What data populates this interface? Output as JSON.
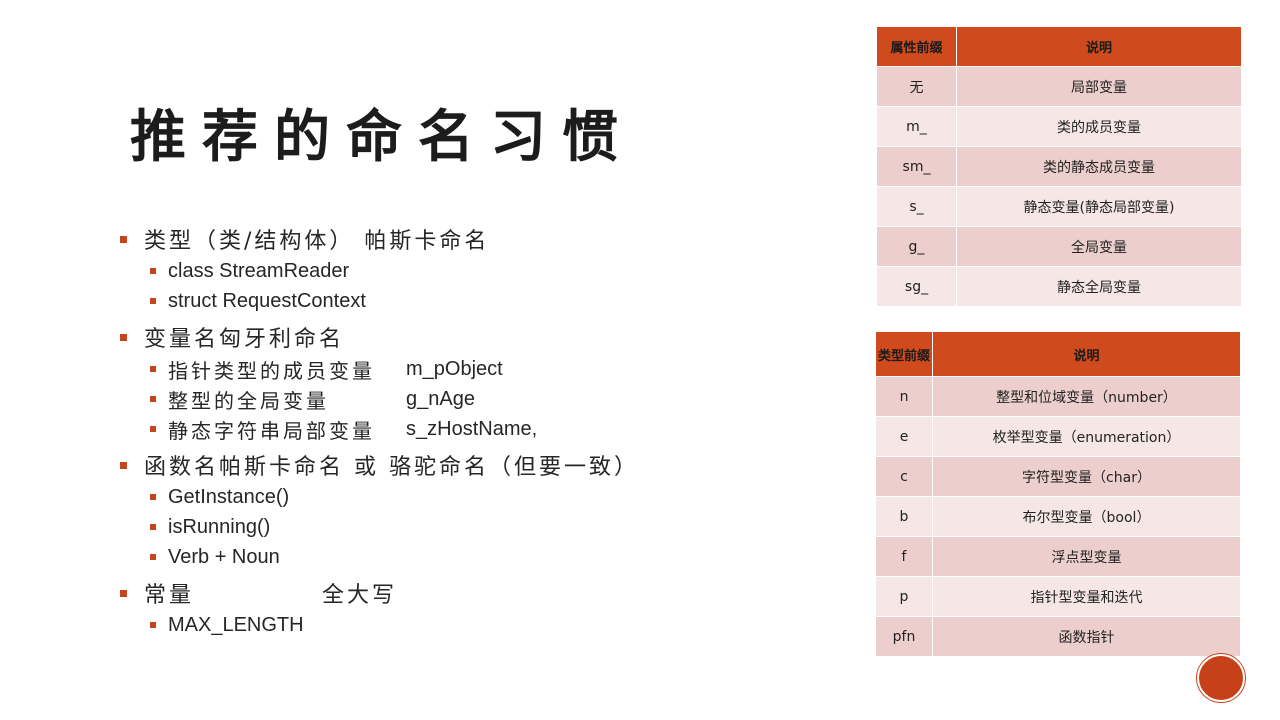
{
  "slide": {
    "title": "推荐的命名习惯",
    "bullets": [
      {
        "label": "类型（类/结构体） 帕斯卡命名",
        "sub": [
          {
            "text": "class StreamReader"
          },
          {
            "text": "struct RequestContext"
          }
        ]
      },
      {
        "label": "变量名匈牙利命名",
        "sub": [
          {
            "desc": "指针类型的成员变量",
            "code": "m_pObject"
          },
          {
            "desc": "整型的全局变量",
            "code": "g_nAge"
          },
          {
            "desc": "静态字符串局部变量",
            "code": "s_zHostName,"
          }
        ]
      },
      {
        "label": "函数名帕斯卡命名 或 骆驼命名（但要一致）",
        "sub": [
          {
            "text": "GetInstance()"
          },
          {
            "text": "isRunning()"
          },
          {
            "text": "Verb + Noun"
          }
        ]
      },
      {
        "label": "常量",
        "label2": "全大写",
        "sub": [
          {
            "text": "MAX_LENGTH"
          }
        ]
      }
    ]
  },
  "attr_table": {
    "headers": [
      "属性前缀",
      "说明"
    ],
    "rows": [
      [
        "无",
        "局部变量"
      ],
      [
        "m_",
        "类的成员变量"
      ],
      [
        "sm_",
        "类的静态成员变量"
      ],
      [
        "s_",
        "静态变量(静态局部变量)"
      ],
      [
        "g_",
        "全局变量"
      ],
      [
        "sg_",
        "静态全局变量"
      ]
    ]
  },
  "type_table": {
    "headers": [
      "类型前缀",
      "说明"
    ],
    "rows": [
      [
        "n",
        "整型和位域变量（number）"
      ],
      [
        "e",
        "枚举型变量（enumeration）"
      ],
      [
        "c",
        "字符型变量（char）"
      ],
      [
        "b",
        "布尔型变量（bool）"
      ],
      [
        "f",
        "浮点型变量"
      ],
      [
        "p",
        "指针型变量和迭代"
      ],
      [
        "pfn",
        "函数指针"
      ]
    ]
  },
  "colors": {
    "accent": "#c5451f",
    "header_bg": "#cf4a1c",
    "row_odd": "#eccfcc",
    "row_even": "#f6e7e6"
  }
}
